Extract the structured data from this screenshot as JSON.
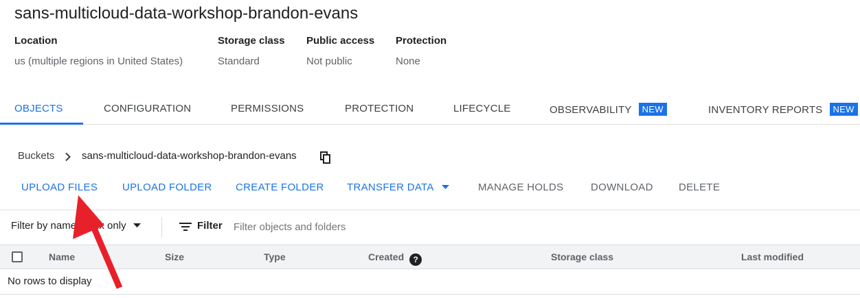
{
  "bucket": {
    "name": "sans-multicloud-data-workshop-brandon-evans"
  },
  "info": [
    {
      "label": "Location",
      "value": "us (multiple regions in United States)"
    },
    {
      "label": "Storage class",
      "value": "Standard"
    },
    {
      "label": "Public access",
      "value": "Not public"
    },
    {
      "label": "Protection",
      "value": "None"
    }
  ],
  "tabs": [
    {
      "label": "OBJECTS",
      "active": true
    },
    {
      "label": "CONFIGURATION"
    },
    {
      "label": "PERMISSIONS"
    },
    {
      "label": "PROTECTION"
    },
    {
      "label": "LIFECYCLE"
    },
    {
      "label": "OBSERVABILITY",
      "badge": "NEW"
    },
    {
      "label": "INVENTORY REPORTS",
      "badge": "NEW"
    }
  ],
  "breadcrumb": {
    "root": "Buckets",
    "current": "sans-multicloud-data-workshop-brandon-evans"
  },
  "actions": {
    "upload_files": "UPLOAD FILES",
    "upload_folder": "UPLOAD FOLDER",
    "create_folder": "CREATE FOLDER",
    "transfer_data": "TRANSFER DATA",
    "manage_holds": "MANAGE HOLDS",
    "download": "DOWNLOAD",
    "delete": "DELETE"
  },
  "filter": {
    "mode": "Filter by name prefix only",
    "label": "Filter",
    "placeholder": "Filter objects and folders"
  },
  "table": {
    "columns": [
      "Name",
      "Size",
      "Type",
      "Created",
      "Storage class",
      "Last modified"
    ],
    "empty_text": "No rows to display"
  },
  "colors": {
    "accent": "#1a73e8",
    "annotation_arrow": "#e8202a"
  }
}
